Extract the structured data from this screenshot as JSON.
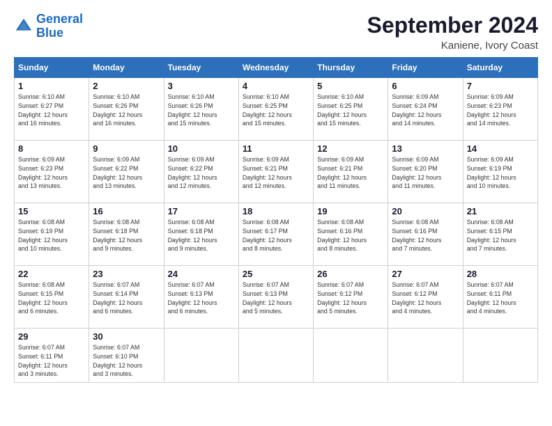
{
  "header": {
    "logo_line1": "General",
    "logo_line2": "Blue",
    "month_title": "September 2024",
    "location": "Kaniene, Ivory Coast"
  },
  "days_of_week": [
    "Sunday",
    "Monday",
    "Tuesday",
    "Wednesday",
    "Thursday",
    "Friday",
    "Saturday"
  ],
  "weeks": [
    [
      {
        "day": "1",
        "sunrise": "Sunrise: 6:10 AM",
        "sunset": "Sunset: 6:27 PM",
        "daylight": "Daylight: 12 hours and 16 minutes."
      },
      {
        "day": "2",
        "sunrise": "Sunrise: 6:10 AM",
        "sunset": "Sunset: 6:26 PM",
        "daylight": "Daylight: 12 hours and 16 minutes."
      },
      {
        "day": "3",
        "sunrise": "Sunrise: 6:10 AM",
        "sunset": "Sunset: 6:26 PM",
        "daylight": "Daylight: 12 hours and 15 minutes."
      },
      {
        "day": "4",
        "sunrise": "Sunrise: 6:10 AM",
        "sunset": "Sunset: 6:25 PM",
        "daylight": "Daylight: 12 hours and 15 minutes."
      },
      {
        "day": "5",
        "sunrise": "Sunrise: 6:10 AM",
        "sunset": "Sunset: 6:25 PM",
        "daylight": "Daylight: 12 hours and 15 minutes."
      },
      {
        "day": "6",
        "sunrise": "Sunrise: 6:09 AM",
        "sunset": "Sunset: 6:24 PM",
        "daylight": "Daylight: 12 hours and 14 minutes."
      },
      {
        "day": "7",
        "sunrise": "Sunrise: 6:09 AM",
        "sunset": "Sunset: 6:23 PM",
        "daylight": "Daylight: 12 hours and 14 minutes."
      }
    ],
    [
      {
        "day": "8",
        "sunrise": "Sunrise: 6:09 AM",
        "sunset": "Sunset: 6:23 PM",
        "daylight": "Daylight: 12 hours and 13 minutes."
      },
      {
        "day": "9",
        "sunrise": "Sunrise: 6:09 AM",
        "sunset": "Sunset: 6:22 PM",
        "daylight": "Daylight: 12 hours and 13 minutes."
      },
      {
        "day": "10",
        "sunrise": "Sunrise: 6:09 AM",
        "sunset": "Sunset: 6:22 PM",
        "daylight": "Daylight: 12 hours and 12 minutes."
      },
      {
        "day": "11",
        "sunrise": "Sunrise: 6:09 AM",
        "sunset": "Sunset: 6:21 PM",
        "daylight": "Daylight: 12 hours and 12 minutes."
      },
      {
        "day": "12",
        "sunrise": "Sunrise: 6:09 AM",
        "sunset": "Sunset: 6:21 PM",
        "daylight": "Daylight: 12 hours and 11 minutes."
      },
      {
        "day": "13",
        "sunrise": "Sunrise: 6:09 AM",
        "sunset": "Sunset: 6:20 PM",
        "daylight": "Daylight: 12 hours and 11 minutes."
      },
      {
        "day": "14",
        "sunrise": "Sunrise: 6:09 AM",
        "sunset": "Sunset: 6:19 PM",
        "daylight": "Daylight: 12 hours and 10 minutes."
      }
    ],
    [
      {
        "day": "15",
        "sunrise": "Sunrise: 6:08 AM",
        "sunset": "Sunset: 6:19 PM",
        "daylight": "Daylight: 12 hours and 10 minutes."
      },
      {
        "day": "16",
        "sunrise": "Sunrise: 6:08 AM",
        "sunset": "Sunset: 6:18 PM",
        "daylight": "Daylight: 12 hours and 9 minutes."
      },
      {
        "day": "17",
        "sunrise": "Sunrise: 6:08 AM",
        "sunset": "Sunset: 6:18 PM",
        "daylight": "Daylight: 12 hours and 9 minutes."
      },
      {
        "day": "18",
        "sunrise": "Sunrise: 6:08 AM",
        "sunset": "Sunset: 6:17 PM",
        "daylight": "Daylight: 12 hours and 8 minutes."
      },
      {
        "day": "19",
        "sunrise": "Sunrise: 6:08 AM",
        "sunset": "Sunset: 6:16 PM",
        "daylight": "Daylight: 12 hours and 8 minutes."
      },
      {
        "day": "20",
        "sunrise": "Sunrise: 6:08 AM",
        "sunset": "Sunset: 6:16 PM",
        "daylight": "Daylight: 12 hours and 7 minutes."
      },
      {
        "day": "21",
        "sunrise": "Sunrise: 6:08 AM",
        "sunset": "Sunset: 6:15 PM",
        "daylight": "Daylight: 12 hours and 7 minutes."
      }
    ],
    [
      {
        "day": "22",
        "sunrise": "Sunrise: 6:08 AM",
        "sunset": "Sunset: 6:15 PM",
        "daylight": "Daylight: 12 hours and 6 minutes."
      },
      {
        "day": "23",
        "sunrise": "Sunrise: 6:07 AM",
        "sunset": "Sunset: 6:14 PM",
        "daylight": "Daylight: 12 hours and 6 minutes."
      },
      {
        "day": "24",
        "sunrise": "Sunrise: 6:07 AM",
        "sunset": "Sunset: 6:13 PM",
        "daylight": "Daylight: 12 hours and 6 minutes."
      },
      {
        "day": "25",
        "sunrise": "Sunrise: 6:07 AM",
        "sunset": "Sunset: 6:13 PM",
        "daylight": "Daylight: 12 hours and 5 minutes."
      },
      {
        "day": "26",
        "sunrise": "Sunrise: 6:07 AM",
        "sunset": "Sunset: 6:12 PM",
        "daylight": "Daylight: 12 hours and 5 minutes."
      },
      {
        "day": "27",
        "sunrise": "Sunrise: 6:07 AM",
        "sunset": "Sunset: 6:12 PM",
        "daylight": "Daylight: 12 hours and 4 minutes."
      },
      {
        "day": "28",
        "sunrise": "Sunrise: 6:07 AM",
        "sunset": "Sunset: 6:11 PM",
        "daylight": "Daylight: 12 hours and 4 minutes."
      }
    ],
    [
      {
        "day": "29",
        "sunrise": "Sunrise: 6:07 AM",
        "sunset": "Sunset: 6:11 PM",
        "daylight": "Daylight: 12 hours and 3 minutes."
      },
      {
        "day": "30",
        "sunrise": "Sunrise: 6:07 AM",
        "sunset": "Sunset: 6:10 PM",
        "daylight": "Daylight: 12 hours and 3 minutes."
      },
      null,
      null,
      null,
      null,
      null
    ]
  ]
}
